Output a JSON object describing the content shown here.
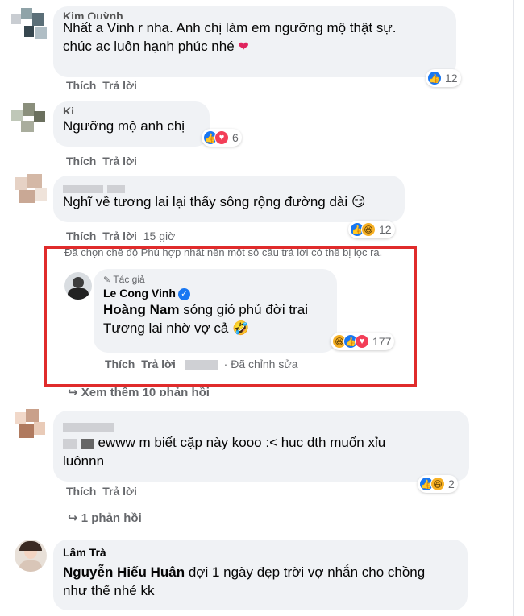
{
  "comments": [
    {
      "name": "Kim Quỳnh",
      "text1": "Nhất a Vinh r nha. Anh chị làm em ngưỡng mộ thật sự.",
      "text2": "chúc ac luôn hạnh phúc nhé",
      "like": "Thích",
      "reply": "Trả lời",
      "reaction_count": "12"
    },
    {
      "name": "Ki",
      "text": "Ngưỡng mộ anh chị",
      "like": "Thích",
      "reply": "Trả lời",
      "reaction_count": "6"
    },
    {
      "text": "Nghĩ về tương lai lại thấy sông rộng đường dài",
      "emoji": "😏",
      "like": "Thích",
      "reply": "Trả lời",
      "time": "15 giờ",
      "reaction_count": "12"
    }
  ],
  "filter_note": "Đã chọn chế độ Phù hợp nhất nên một số câu trả lời có thể bị lọc ra.",
  "reply_highlight": {
    "badge": "Tác giả",
    "name": "Le Cong Vinh",
    "tag": "Hoàng Nam",
    "text1": " sóng gió phủ đời trai",
    "text2": "Tương lai nhờ vợ cả",
    "emoji": "🤣",
    "like": "Thích",
    "reply": "Trả lời",
    "edited": "· Đã chỉnh sửa",
    "reaction_count": "177"
  },
  "see_more": "↪ Xem thêm 10 phản hồi",
  "comment4": {
    "text1": "ewww m biết cặp này kooo :< huc dth muốn xỉu",
    "text2": "luônnn",
    "like": "Thích",
    "reply": "Trả lời",
    "reaction_count": "2"
  },
  "replies_link": "↪ 1 phản hồi",
  "comment5": {
    "name": "Lâm Trà",
    "tag": "Nguyễn Hiếu Huân",
    "text1": " đợi 1 ngày đẹp trời vợ nhắn cho chồng",
    "text2": "như thế nhé kk"
  },
  "colors": {
    "bubble": "#f0f2f5",
    "highlight_border": "#e02b2b",
    "like_blue": "#1877f2",
    "love_red": "#f33e58"
  }
}
